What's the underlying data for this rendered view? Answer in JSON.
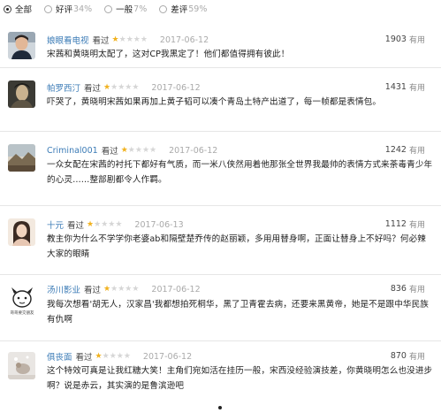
{
  "filters": [
    {
      "label": "全部",
      "pct": "",
      "checked": true
    },
    {
      "label": "好评",
      "pct": "34%",
      "checked": false
    },
    {
      "label": "一般",
      "pct": "7%",
      "checked": false
    },
    {
      "label": "差评",
      "pct": "59%",
      "checked": false
    }
  ],
  "star_color": "#f1b21f",
  "link_color": "#3b7bb6",
  "comments": [
    {
      "user": "娘眼看电视",
      "verb": "看过",
      "rating": 1,
      "date": "2017-06-12",
      "votes": "1903",
      "vote_label": "有用",
      "text": "宋茜和黄晓明太配了，这对CP我黑定了！他们都值得拥有彼此！",
      "avatar": "male-portrait"
    },
    {
      "user": "帕罗西汀",
      "verb": "看过",
      "rating": 1,
      "date": "2017-06-12",
      "votes": "1431",
      "vote_label": "有用",
      "text": "吓哭了，黄晓明宋茜如果再加上黄子韬可以凑个青岛土特产出道了，每一帧都是表情包。",
      "avatar": "painting-portrait"
    },
    {
      "user": "Criminal001",
      "verb": "看过",
      "rating": 1,
      "date": "2017-06-12",
      "votes": "1242",
      "vote_label": "有用",
      "text": "一众女配在宋茜的衬托下都好有气质，而一米八侠然用着他那张全世界我最帅的表情方式来荼毒青少年的心灵……整部剧都令人作羁。",
      "avatar": "landscape-photo"
    },
    {
      "user": "十元",
      "verb": "看过",
      "rating": 1,
      "date": "2017-06-13",
      "votes": "1112",
      "vote_label": "有用",
      "text": "教主你为什么不学学你老婆ab和隔壁楚乔传的赵丽颖，多用用替身啊，正面让替身上不好吗？何必辣大家的眼睛",
      "avatar": "female-portrait"
    },
    {
      "user": "汤川影业",
      "verb": "看过",
      "rating": 1,
      "date": "2017-06-12",
      "votes": "836",
      "vote_label": "有用",
      "text": "我每次想看'胡无人，汉家昌'我都想拍死桐华，黑了卫青霍去病，还要来黑黄帝，她是不是跟中华民族有仇啊",
      "avatar": "cartoon-logo",
      "avatar_caption": "哥哥要交朋友"
    },
    {
      "user": "俱丧面",
      "verb": "看过",
      "rating": 1,
      "date": "2017-06-12",
      "votes": "870",
      "vote_label": "有用",
      "text": "这个特效可真是让我红糖大笑！主角们宛如活在挂历一般，宋西没经验演技差，你黄晓明怎么也没进步啊？说是赤云，其实演的是鲁滨逊吧",
      "avatar": "snowy-photo"
    }
  ]
}
